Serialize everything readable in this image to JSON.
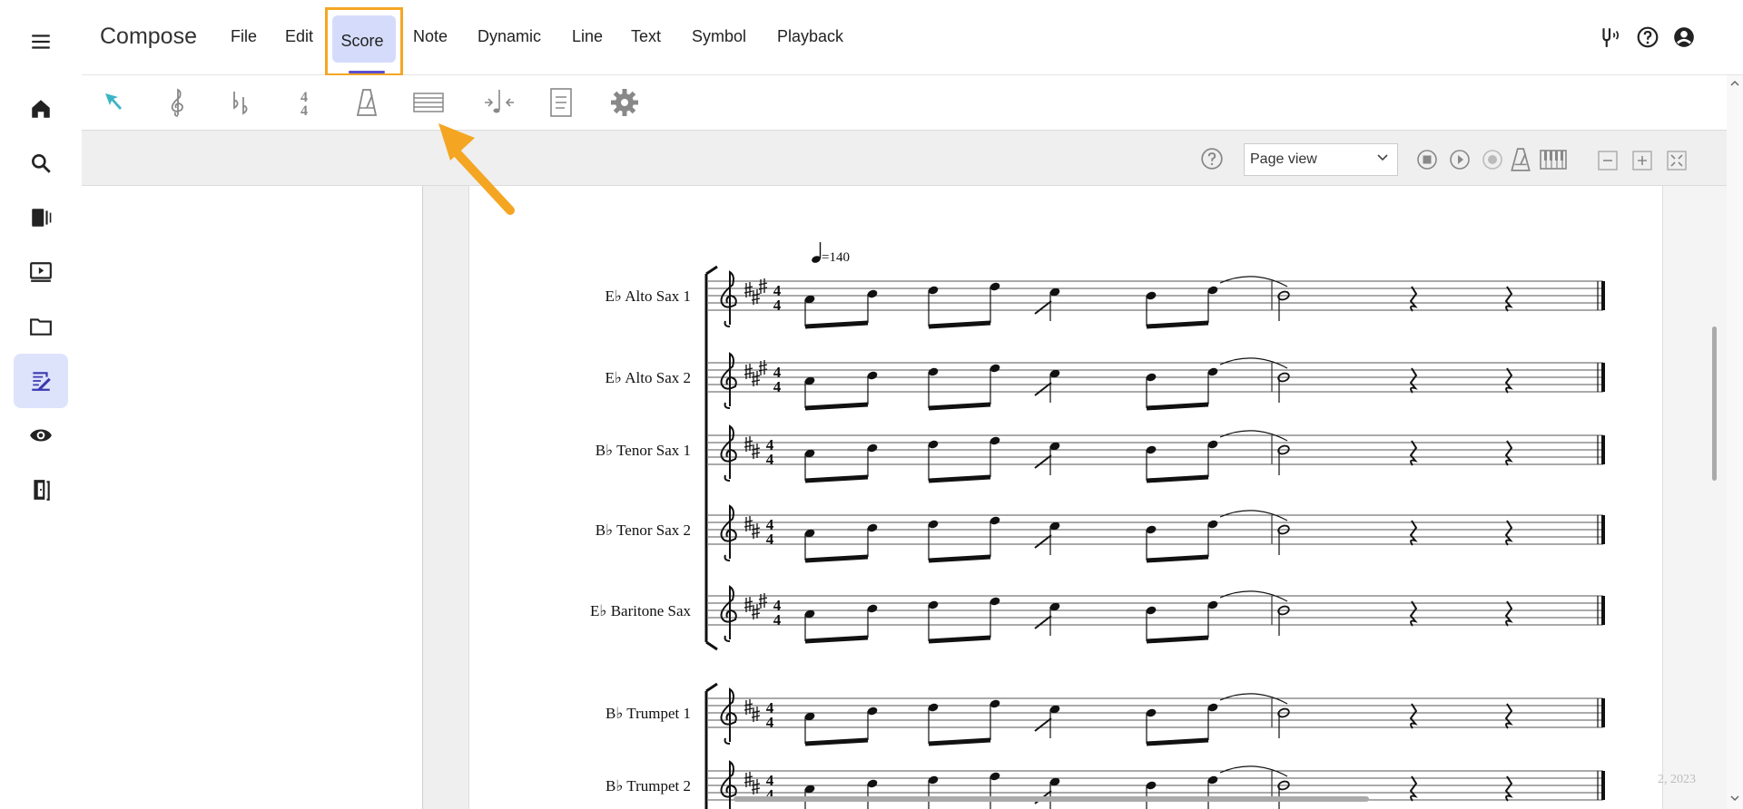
{
  "app": {
    "title": "Compose"
  },
  "menu": {
    "file": "File",
    "edit": "Edit",
    "score": "Score",
    "note": "Note",
    "dynamic": "Dynamic",
    "line": "Line",
    "text": "Text",
    "symbol": "Symbol",
    "playback": "Playback"
  },
  "sidebar": {
    "items": [
      "menu-icon",
      "home-icon",
      "search-icon",
      "library-icon",
      "video-icon",
      "folder-icon",
      "compose-icon",
      "eye-icon",
      "exit-icon"
    ],
    "active": "compose-icon"
  },
  "toolbar": {
    "tools": [
      "select-arrow-icon",
      "clef-icon",
      "key-signature-icon",
      "time-signature-icon",
      "metronome-icon",
      "staff-lines-icon",
      "insert-measure-icon",
      "page-icon",
      "gear-icon"
    ],
    "time_sig_top": "4",
    "time_sig_bottom": "4"
  },
  "viewbar": {
    "view_mode": "Page view"
  },
  "score": {
    "tempo": "=140",
    "instruments": [
      "E♭ Alto Sax 1",
      "E♭ Alto Sax 2",
      "B♭ Tenor Sax 1",
      "B♭ Tenor Sax 2",
      "E♭ Baritone Sax",
      "B♭ Trumpet 1",
      "B♭ Trumpet 2"
    ],
    "time_signature_top": "4",
    "time_signature_bottom": "4"
  },
  "footer": {
    "date_fragment": "2, 2023"
  },
  "colors": {
    "accent": "#5a4fcf",
    "highlight": "#f4a623",
    "active_bg": "#dde3fb",
    "tool_arrow": "#3bb5c6"
  }
}
